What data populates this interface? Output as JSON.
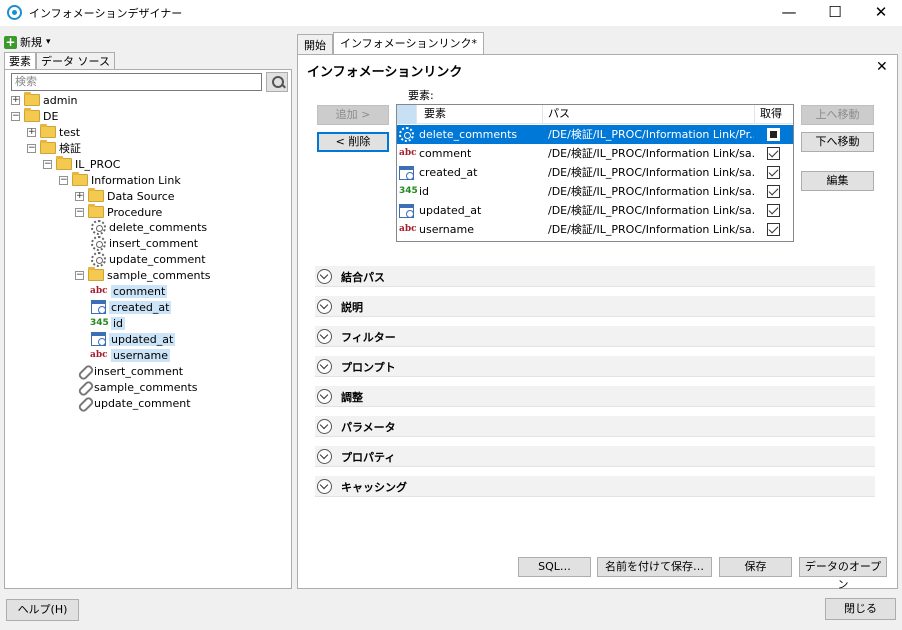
{
  "window": {
    "title": "インフォメーションデザイナー",
    "min": "—",
    "max": "☐",
    "close": "✕"
  },
  "left": {
    "new_label": "新規",
    "new_arrow": "▾",
    "tabs": [
      "要素",
      "データ ソース"
    ],
    "search_placeholder": "検索",
    "tree": [
      {
        "label": "admin",
        "icon": "folder",
        "exp": "+"
      },
      {
        "label": "DE",
        "icon": "folder",
        "exp": "−"
      },
      {
        "label": "test",
        "icon": "folder",
        "exp": "+"
      },
      {
        "label": "検証",
        "icon": "folder",
        "exp": "−"
      },
      {
        "label": "IL_PROC",
        "icon": "folder",
        "exp": "−"
      },
      {
        "label": "Information Link",
        "icon": "folder",
        "exp": "−"
      },
      {
        "label": "Data Source",
        "icon": "folder",
        "exp": "+"
      },
      {
        "label": "Procedure",
        "icon": "folder",
        "exp": "−"
      },
      {
        "label": "delete_comments",
        "icon": "gear"
      },
      {
        "label": "insert_comment",
        "icon": "gear"
      },
      {
        "label": "update_comment",
        "icon": "gear"
      },
      {
        "label": "sample_comments",
        "icon": "folder",
        "exp": "−"
      },
      {
        "label": "comment",
        "icon": "abc",
        "type_text": "abc"
      },
      {
        "label": "created_at",
        "icon": "calendar"
      },
      {
        "label": "id",
        "icon": "number",
        "type_text": "345"
      },
      {
        "label": "updated_at",
        "icon": "calendar"
      },
      {
        "label": "username",
        "icon": "abc",
        "type_text": "abc"
      },
      {
        "label": "insert_comment",
        "icon": "link"
      },
      {
        "label": "sample_comments",
        "icon": "link"
      },
      {
        "label": "update_comment",
        "icon": "link"
      }
    ],
    "help_label": "ヘルプ(H)"
  },
  "right": {
    "tabs": [
      "開始",
      "インフォメーションリンク*"
    ],
    "title": "インフォメーションリンク",
    "close": "✕",
    "elements_label": "要素:",
    "buttons": {
      "add": "追加 >",
      "remove": "< 削除",
      "move_up": "上へ移動",
      "move_down": "下へ移動",
      "edit": "編集"
    },
    "grid": {
      "headers": [
        "要素",
        "パス",
        "取得"
      ],
      "rows": [
        {
          "icon": "gear",
          "name": "delete_comments",
          "path": "/DE/検証/IL_PROC/Information Link/Pr...",
          "check": "square",
          "selected": true
        },
        {
          "icon": "abc",
          "type_text": "abc",
          "name": "comment",
          "path": "/DE/検証/IL_PROC/Information Link/sa...",
          "check": "checked"
        },
        {
          "icon": "calendar",
          "name": "created_at",
          "path": "/DE/検証/IL_PROC/Information Link/sa...",
          "check": "checked"
        },
        {
          "icon": "number",
          "type_text": "345",
          "name": "id",
          "path": "/DE/検証/IL_PROC/Information Link/sa...",
          "check": "checked"
        },
        {
          "icon": "calendar",
          "name": "updated_at",
          "path": "/DE/検証/IL_PROC/Information Link/sa...",
          "check": "checked"
        },
        {
          "icon": "abc",
          "type_text": "abc",
          "name": "username",
          "path": "/DE/検証/IL_PROC/Information Link/sa...",
          "check": "checked"
        }
      ]
    },
    "sections": [
      "結合パス",
      "説明",
      "フィルター",
      "プロンプト",
      "調整",
      "パラメータ",
      "プロパティ",
      "キャッシング"
    ],
    "footer": {
      "sql": "SQL…",
      "save_as": "名前を付けて保存…",
      "save": "保存",
      "open_data": "データのオープン"
    }
  },
  "close_label": "閉じる"
}
